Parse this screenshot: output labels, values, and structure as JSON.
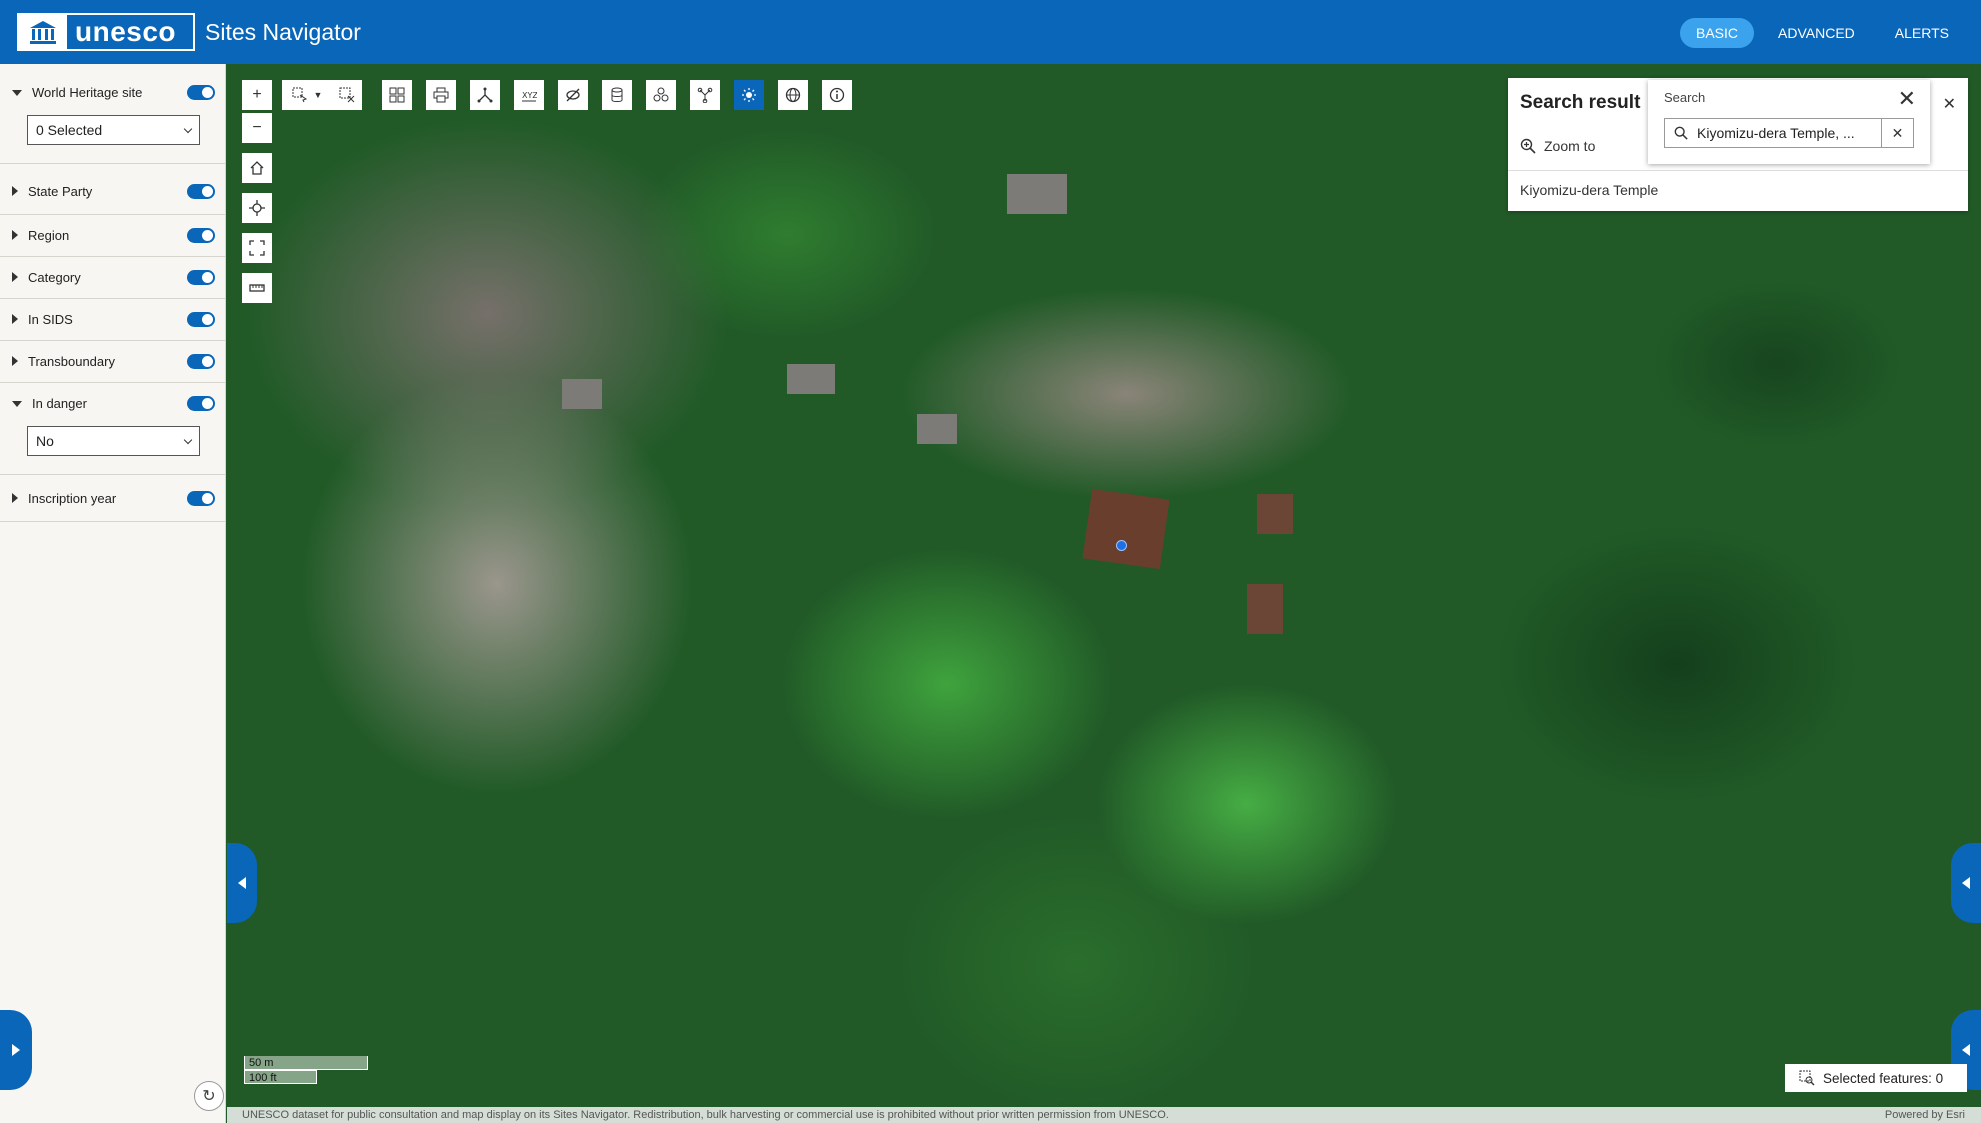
{
  "header": {
    "logo_text": "unesco",
    "title": "Sites Navigator",
    "tabs": [
      {
        "label": "BASIC",
        "active": true
      },
      {
        "label": "ADVANCED",
        "active": false
      },
      {
        "label": "ALERTS",
        "active": false
      }
    ],
    "brand_color": "#0a66b8"
  },
  "sidebar": {
    "filters": [
      {
        "label": "World Heritage site",
        "expanded": true,
        "enabled": true,
        "select_value": "0 Selected"
      },
      {
        "label": "State Party",
        "expanded": false,
        "enabled": true
      },
      {
        "label": "Region",
        "expanded": false,
        "enabled": true
      },
      {
        "label": "Category",
        "expanded": false,
        "enabled": true
      },
      {
        "label": "In SIDS",
        "expanded": false,
        "enabled": true
      },
      {
        "label": "Transboundary",
        "expanded": false,
        "enabled": true
      },
      {
        "label": "In danger",
        "expanded": true,
        "enabled": true,
        "select_value": "No"
      },
      {
        "label": "Inscription year",
        "expanded": false,
        "enabled": true
      }
    ]
  },
  "map_tools": {
    "zoom": [
      "zoom-in-icon",
      "zoom-out-icon",
      "home-icon",
      "locate-icon",
      "fullscreen-icon",
      "measure-icon"
    ],
    "toolbar": [
      "select-icon",
      "clear-selection-icon",
      "grid-icon",
      "print-icon",
      "network-icon",
      "xyz-icon",
      "layers-off-icon",
      "database-icon",
      "cluster-icon",
      "graph-icon",
      "sun-icon",
      "globe-icon",
      "info-icon"
    ],
    "active_tool": "sun-icon"
  },
  "search_result": {
    "title": "Search result",
    "zoom_to": "Zoom to",
    "items": [
      "Kiyomizu-dera Temple"
    ]
  },
  "search": {
    "label": "Search",
    "value": "Kiyomizu-dera Temple, ..."
  },
  "scale": {
    "metric": "50 m",
    "imperial": "100 ft"
  },
  "selected_features": "Selected features: 0",
  "footer": {
    "disclaimer": "UNESCO dataset for public consultation and map display on its Sites Navigator. Redistribution, bulk harvesting or commercial use is prohibited without prior written permission from UNESCO.",
    "powered_by": "Powered by Esri"
  }
}
